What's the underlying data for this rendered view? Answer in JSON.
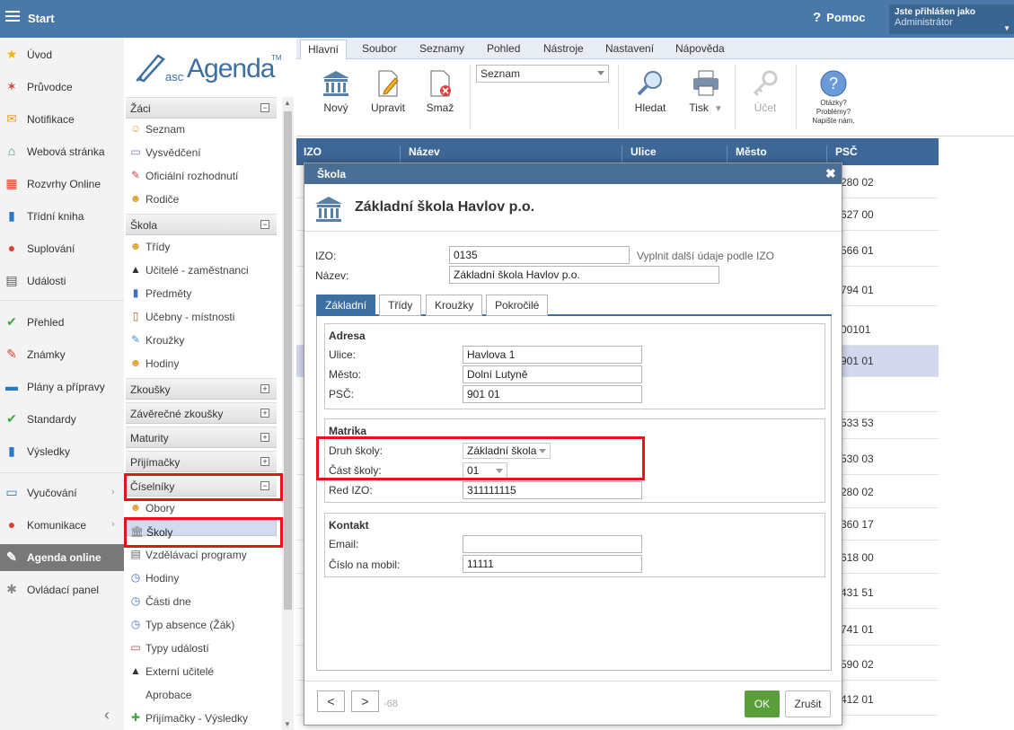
{
  "topbar": {
    "start": "Start",
    "help": "Pomoc",
    "logged_as": "Jste přihlášen jako",
    "user": "Administrátor"
  },
  "leftnav": [
    {
      "label": "Úvod",
      "icon": "star-icon",
      "glyph": "★",
      "color": "#f0b400"
    },
    {
      "label": "Průvodce",
      "icon": "wand-icon",
      "glyph": "✶",
      "color": "#e04030"
    },
    {
      "label": "Notifikace",
      "icon": "envelope-icon",
      "glyph": "✉",
      "color": "#f0a020"
    },
    {
      "label": "Webová stránka",
      "icon": "home-icon",
      "glyph": "⌂",
      "color": "#2a9a5a"
    },
    {
      "label": "Rozvrhy Online",
      "icon": "grid-icon",
      "glyph": "▦",
      "color": "#e04030"
    },
    {
      "label": "Třídní kniha",
      "icon": "book-icon",
      "glyph": "▮",
      "color": "#2a78c8"
    },
    {
      "label": "Suplování",
      "icon": "person-icon",
      "glyph": "●",
      "color": "#e04030"
    },
    {
      "label": "Události",
      "icon": "calendar-icon",
      "glyph": "▤",
      "color": "#555555"
    },
    {
      "label": "Přehled",
      "icon": "check-icon",
      "glyph": "✔",
      "color": "#3aaa3a"
    },
    {
      "label": "Známky",
      "icon": "grade-icon",
      "glyph": "✎",
      "color": "#e04030"
    },
    {
      "label": "Plány a přípravy",
      "icon": "briefcase-icon",
      "glyph": "▬",
      "color": "#2a78c8"
    },
    {
      "label": "Standardy",
      "icon": "shield-icon",
      "glyph": "✔",
      "color": "#3aaa3a"
    },
    {
      "label": "Výsledky",
      "icon": "bar-chart-icon",
      "glyph": "▮",
      "color": "#2a78c8"
    },
    {
      "label": "Vyučování",
      "icon": "teaching-icon",
      "glyph": "▭",
      "color": "#2a78c8"
    },
    {
      "label": "Komunikace",
      "icon": "chat-icon",
      "glyph": "●",
      "color": "#e04030"
    },
    {
      "label": "Agenda online",
      "icon": "agenda-icon",
      "glyph": "✎",
      "color": "#ffffff"
    },
    {
      "label": "Ovládací panel",
      "icon": "gear-icon",
      "glyph": "✱",
      "color": "#888888"
    }
  ],
  "logo": {
    "asc": "asc",
    "agenda": "Agenda",
    "tm": "TM"
  },
  "catalog": {
    "sec_zaci": "Žáci",
    "seznam": "Seznam",
    "vysvedceni": "Vysvědčení",
    "oficialni": "Oficiální rozhodnutí",
    "rodice": "Rodiče",
    "sec_skola": "Škola",
    "tridy": "Třídy",
    "ucitele": "Učitelé - zaměstnanci",
    "predmety": "Předměty",
    "ucebny": "Učebny - místnosti",
    "krouzky": "Kroužky",
    "hodiny": "Hodiny",
    "sec_zkousky": "Zkoušky",
    "sec_zaverecne": "Závěrečné zkoušky",
    "sec_maturity": "Maturity",
    "sec_prijimacky": "Přijímačky",
    "sec_ciselniky": "Číselníky",
    "obory": "Obory",
    "skoly": "Školy",
    "vzdelavaci": "Vzdělávací programy",
    "hodiny2": "Hodiny",
    "casti_dne": "Části dne",
    "typ_absence": "Typ absence (Žák)",
    "typy_udalosti": "Typy událostí",
    "externi": "Externí učitelé",
    "aprobace": "Aprobace",
    "prijimacky_vysledky": "Přijímačky - Výsledky",
    "minus": "−",
    "plus": "+"
  },
  "ribbon": {
    "tabs": [
      "Hlavní",
      "Soubor",
      "Seznamy",
      "Pohled",
      "Nástroje",
      "Nastavení",
      "Nápověda"
    ],
    "novy": "Nový",
    "upravit": "Upravit",
    "smaz": "Smaž",
    "select_value": "Seznam",
    "hledat": "Hledat",
    "tisk": "Tisk",
    "ucet": "Účet",
    "help_q1": "Otázky?",
    "help_q2": "Problémy?",
    "help_q3": "Napište nám."
  },
  "grid": {
    "headers": [
      "IZO",
      "Název",
      "Ulice",
      "Město",
      "PSČ"
    ],
    "psc": [
      "280 02",
      "627 00",
      "566 01",
      "794 01",
      "00101",
      "901 01",
      "",
      "533 53",
      "530 03",
      "280 02",
      "360 17",
      "618 00",
      "431 51",
      "741 01",
      "590 02",
      "412 01"
    ]
  },
  "modal": {
    "title": "Škola",
    "close": "✖",
    "heading": "Základní škola Havlov p.o.",
    "izo_label": "IZO:",
    "izo": "0135",
    "izo_hint": "Vyplnit další údaje podle IZO",
    "nazev_label": "Název:",
    "nazev": "Základní škola Havlov p.o.",
    "tabs": [
      "Základní",
      "Třídy",
      "Kroužky",
      "Pokročilé"
    ],
    "adresa": "Adresa",
    "ulice_label": "Ulice:",
    "ulice": "Havlova 1",
    "mesto_label": "Město:",
    "mesto": "Dolní Lutyně",
    "psc_label": "PSČ:",
    "psc": "901 01",
    "matrika": "Matrika",
    "druh_label": "Druh školy:",
    "druh": "Základní škola",
    "cast_label": "Část školy:",
    "cast": "01",
    "redizo_label": "Red IZO:",
    "redizo": "311111115",
    "kontakt": "Kontakt",
    "email_label": "Email:",
    "email": "",
    "mobil_label": "Číslo na mobil:",
    "mobil": "11111",
    "prev": "<",
    "next": ">",
    "counter": "-68",
    "ok": "OK",
    "cancel": "Zrušit"
  }
}
